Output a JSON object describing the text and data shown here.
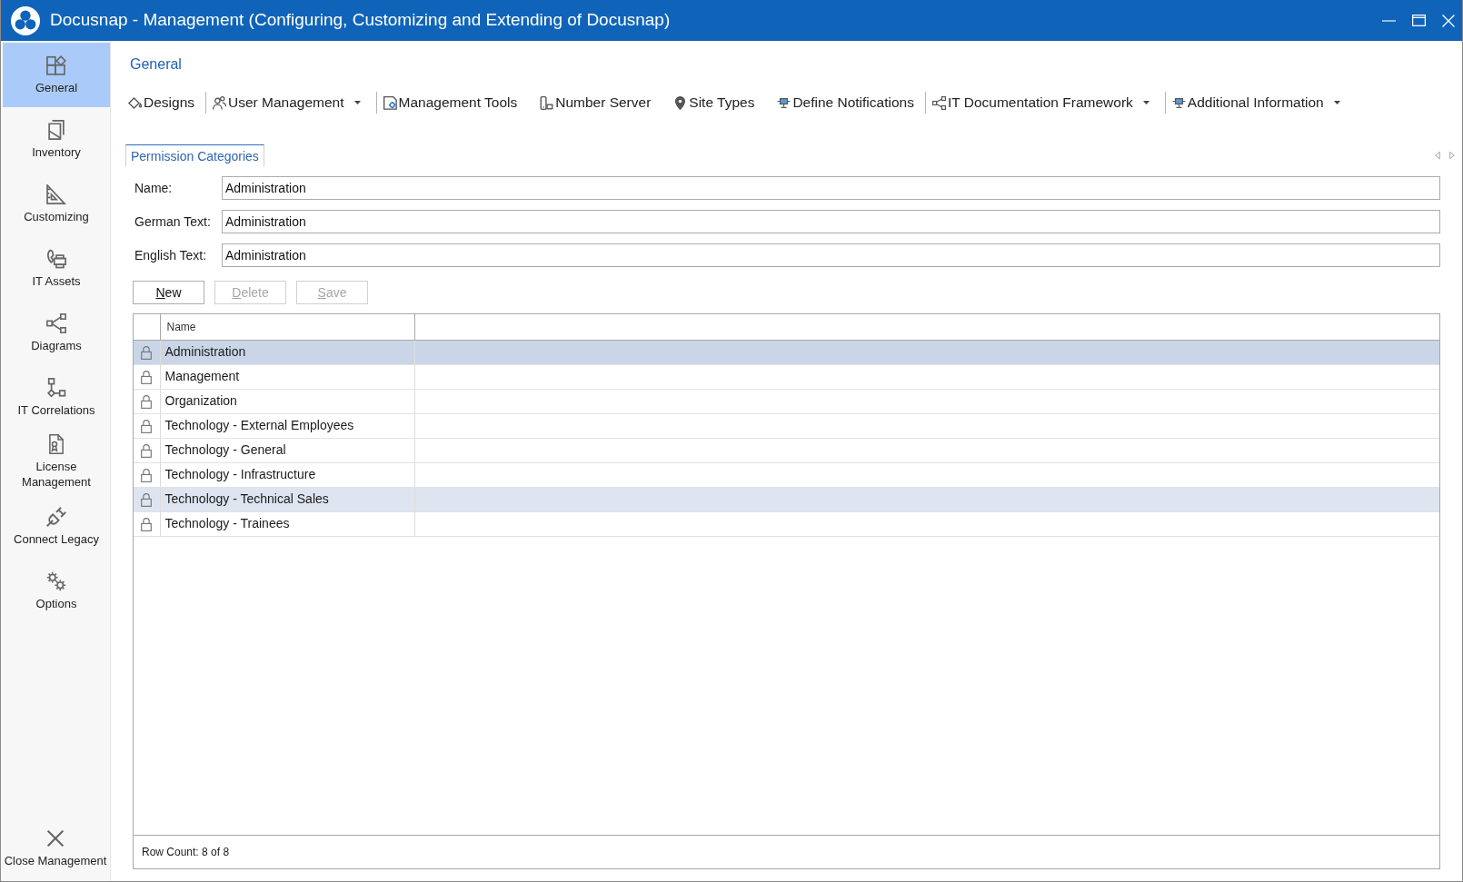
{
  "window": {
    "title": "Docusnap - Management (Configuring, Customizing and Extending of Docusnap)"
  },
  "sidebar": {
    "items": [
      {
        "label": "General",
        "selected": true
      },
      {
        "label": "Inventory",
        "selected": false
      },
      {
        "label": "Customizing",
        "selected": false
      },
      {
        "label": "IT Assets",
        "selected": false
      },
      {
        "label": "Diagrams",
        "selected": false
      },
      {
        "label": "IT Correlations",
        "selected": false
      },
      {
        "label": "License Management",
        "selected": false
      },
      {
        "label": "Connect Legacy",
        "selected": false
      },
      {
        "label": "Options",
        "selected": false
      }
    ],
    "close_action": {
      "label": "Close Management"
    }
  },
  "section": {
    "title": "General"
  },
  "toolbar": {
    "groups": [
      {
        "items": [
          {
            "label": "Designs",
            "dropdown": false
          }
        ]
      },
      {
        "items": [
          {
            "label": "User Management",
            "dropdown": true
          }
        ]
      },
      {
        "items": [
          {
            "label": "Management Tools",
            "dropdown": false
          },
          {
            "label": "Number Server",
            "dropdown": false
          },
          {
            "label": "Site Types",
            "dropdown": false
          },
          {
            "label": "Define Notifications",
            "dropdown": false
          }
        ]
      },
      {
        "items": [
          {
            "label": "IT Documentation Framework",
            "dropdown": true
          }
        ]
      },
      {
        "items": [
          {
            "label": "Additional Information",
            "dropdown": true
          }
        ]
      }
    ]
  },
  "tabs": [
    {
      "label": "Permission Categories",
      "selected": true
    }
  ],
  "form": {
    "fields": [
      {
        "label": "Name:",
        "value": "Administration"
      },
      {
        "label": "German Text:",
        "value": "Administration"
      },
      {
        "label": "English Text:",
        "value": "Administration"
      }
    ]
  },
  "buttons": [
    {
      "label": "New",
      "disabled": false
    },
    {
      "label": "Delete",
      "disabled": true
    },
    {
      "label": "Save",
      "disabled": true
    }
  ],
  "grid": {
    "columns": [
      "Name"
    ],
    "rows": [
      {
        "name": "Administration",
        "locked": true,
        "selected": true,
        "highlighted": false
      },
      {
        "name": "Management",
        "locked": true,
        "selected": false,
        "highlighted": false
      },
      {
        "name": "Organization",
        "locked": true,
        "selected": false,
        "highlighted": false
      },
      {
        "name": "Technology - External Employees",
        "locked": true,
        "selected": false,
        "highlighted": false
      },
      {
        "name": "Technology - General",
        "locked": true,
        "selected": false,
        "highlighted": false
      },
      {
        "name": "Technology - Infrastructure",
        "locked": true,
        "selected": false,
        "highlighted": false
      },
      {
        "name": "Technology - Technical Sales",
        "locked": true,
        "selected": false,
        "highlighted": true
      },
      {
        "name": "Technology - Trainees",
        "locked": true,
        "selected": false,
        "highlighted": false
      }
    ],
    "footer": "Row Count: 8 of 8"
  }
}
